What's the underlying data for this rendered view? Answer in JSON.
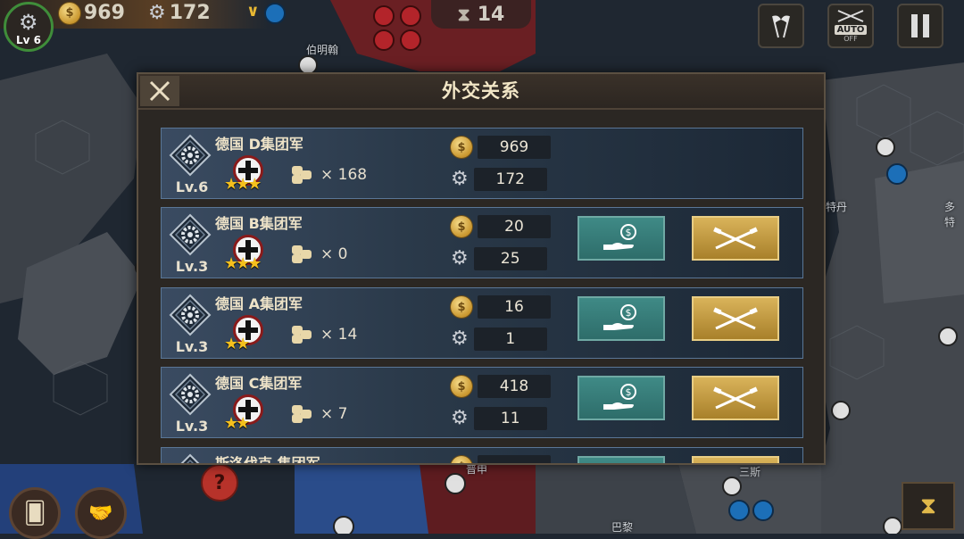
{
  "hud": {
    "level": "Lv 6",
    "gold": "969",
    "industry": "172",
    "turn": "14",
    "auto_label": "AUTO",
    "auto_state": "OFF"
  },
  "map_labels": [
    "伯明翰",
    "特丹",
    "多特",
    "巴黎",
    "三斯",
    "普申"
  ],
  "dialog": {
    "title": "外交关系",
    "rows": [
      {
        "name": "德国 D集团军",
        "level": "Lv.6",
        "stars": "★★★",
        "troops": "× 168",
        "gold": "969",
        "industry": "172",
        "actions": false
      },
      {
        "name": "德国 B集团军",
        "level": "Lv.3",
        "stars": "★★★",
        "troops": "× 0",
        "gold": "20",
        "industry": "25",
        "actions": true
      },
      {
        "name": "德国 A集团军",
        "level": "Lv.3",
        "stars": "★★",
        "troops": "× 14",
        "gold": "16",
        "industry": "1",
        "actions": true
      },
      {
        "name": "德国 C集团军",
        "level": "Lv.3",
        "stars": "★★",
        "troops": "× 7",
        "gold": "418",
        "industry": "11",
        "actions": true
      },
      {
        "name": "斯洛伐克 集团军",
        "level": "",
        "stars": "",
        "troops": "",
        "gold": "",
        "industry": "",
        "actions": true
      }
    ]
  },
  "colors": {
    "accent_gold": "#d9b35a",
    "aid_teal": "#3f8a86",
    "row_blue": "#3a4b61",
    "enemy_red": "#8a1b1b"
  },
  "icons": {
    "close": "close-icon",
    "aid": "money-hand-icon",
    "war": "crossed-rifles-icon",
    "gold": "coin-icon",
    "industry": "gear-icon"
  }
}
